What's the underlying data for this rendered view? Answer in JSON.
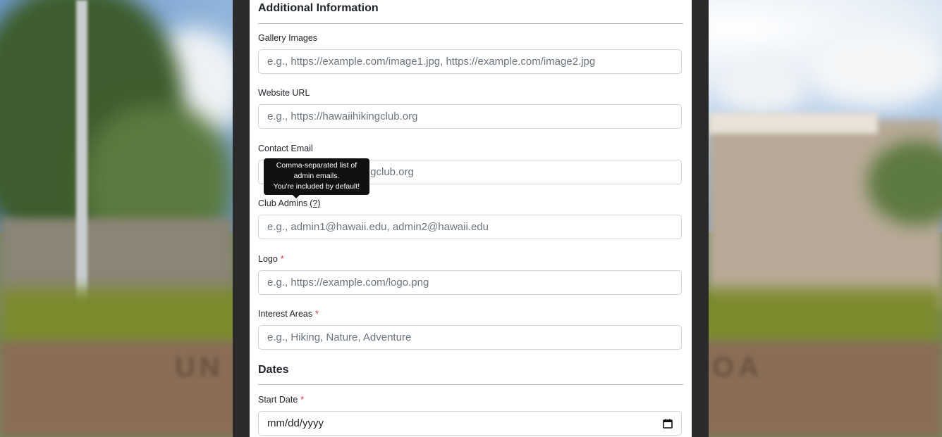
{
  "sections": {
    "additional": "Additional Information",
    "dates": "Dates"
  },
  "fields": {
    "gallery": {
      "label": "Gallery Images",
      "placeholder": "e.g., https://example.com/image1.jpg, https://example.com/image2.jpg"
    },
    "website": {
      "label": "Website URL",
      "placeholder": "e.g., https://hawaiihikingclub.org"
    },
    "email": {
      "label": "Contact Email",
      "placeholder": "e.g., info@hawaiihikingclub.org"
    },
    "admins": {
      "label": "Club Admins",
      "help": "(?)",
      "placeholder": "e.g., admin1@hawaii.edu, admin2@hawaii.edu"
    },
    "logo": {
      "label": "Logo",
      "required": "*",
      "placeholder": "e.g., https://example.com/logo.png"
    },
    "interests": {
      "label": "Interest Areas",
      "required": "*",
      "placeholder": "e.g., Hiking, Nature, Adventure"
    },
    "start_date": {
      "label": "Start Date",
      "required": "*",
      "value": "mm/dd/yyyy"
    }
  },
  "tooltip": {
    "line1": "Comma-separated list of",
    "line2": "admin emails.",
    "line3": "You're included by default!"
  },
  "background": {
    "wall_left": "UN",
    "wall_right": "OA"
  },
  "colors": {
    "required": "#dc3545",
    "tooltip_bg": "#111111"
  },
  "icons": {
    "date_picker": "calendar-icon"
  }
}
